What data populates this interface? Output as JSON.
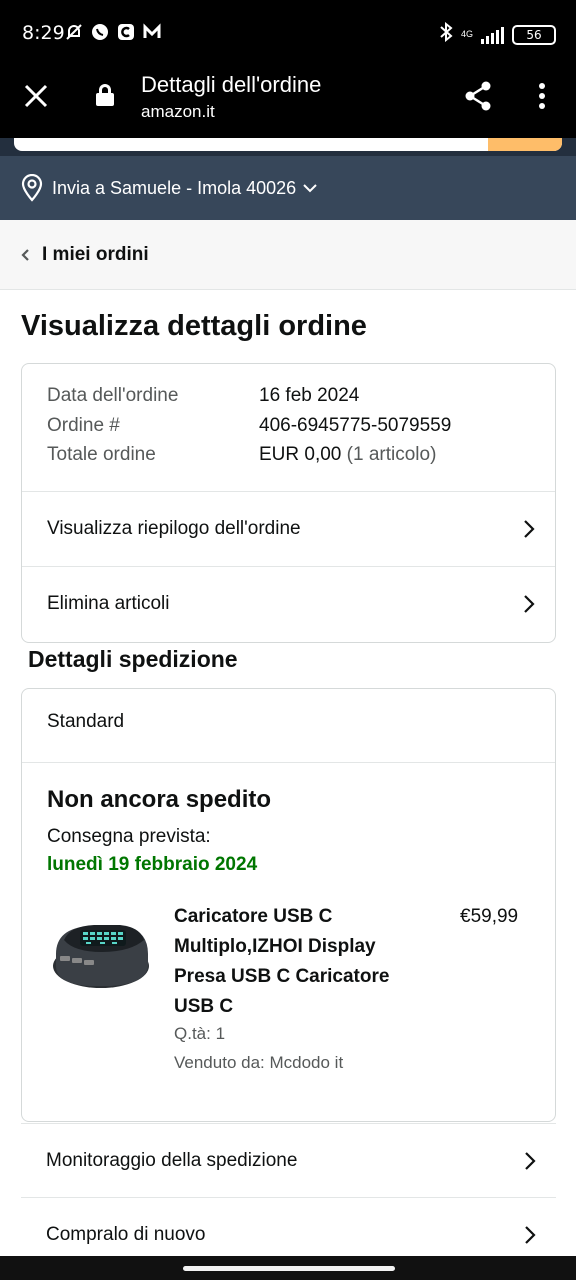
{
  "status_bar": {
    "time": "8:29",
    "network": "4G",
    "battery": "56"
  },
  "browser": {
    "title": "Dettagli dell'ordine",
    "url": "amazon.it"
  },
  "deliver": {
    "text": "Invia a Samuele - Imola 40026"
  },
  "breadcrumb": {
    "label": "I miei ordini"
  },
  "page": {
    "title": "Visualizza dettagli ordine"
  },
  "order_info": {
    "date_label": "Data dell'ordine",
    "date_value": "16 feb 2024",
    "number_label": "Ordine #",
    "number_value": "406-6945775-5079559",
    "total_label": "Totale ordine",
    "total_value": "EUR 0,00",
    "total_items": "(1 articolo)",
    "summary_link": "Visualizza riepilogo dell'ordine",
    "delete_link": "Elimina articoli"
  },
  "shipping": {
    "section_title": "Dettagli spedizione",
    "type": "Standard",
    "status": "Non ancora spedito",
    "delivery_label": "Consegna prevista:",
    "delivery_date": "lunedì 19 febbraio 2024",
    "product": {
      "name": "Caricatore USB C Multiplo,IZHOI Display Presa USB C Caricatore USB C",
      "price": "€59,99",
      "qty": "Q.tà: 1",
      "seller": "Venduto da: Mcdodo it"
    }
  },
  "actions": {
    "track": "Monitoraggio della spedizione",
    "buy_again": "Compralo di nuovo"
  },
  "colors": {
    "header_dark": "#37475a",
    "delivery_green": "#007600",
    "search_button": "#febd69"
  }
}
